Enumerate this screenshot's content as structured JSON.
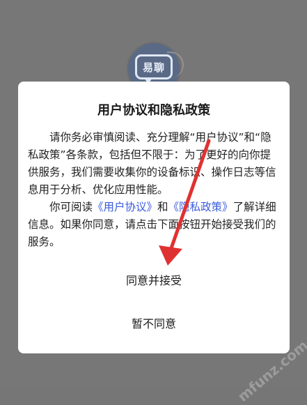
{
  "app": {
    "logo_text": "易聊"
  },
  "dialog": {
    "title": "用户协议和隐私政策",
    "paragraph1": "请你务必审慎阅读、充分理解“用户协议”和“隐私政策”各条款，包括但不限于：为了更好的向你提供服务，我们需要收集你的设备标识、操作日志等信息用于分析、优化应用性能。",
    "paragraph2_prefix": "你可阅读",
    "user_agreement_link": "《用户协议》",
    "paragraph2_and": "和",
    "privacy_policy_link": "《隐私政策》",
    "paragraph2_suffix": "了解详细信息。如果你同意，请点击下面按钮开始接受我们的服务。",
    "agree_button": "同意并接受",
    "reject_button": "暂不同意"
  },
  "watermark": {
    "text": "mfunz.com"
  },
  "colors": {
    "backdrop": "#777777",
    "dialog_bg": "#ffffff",
    "link": "#3b5bdb",
    "arrow": "#e03131"
  },
  "icons": {
    "logo": "chat-bubble-icon",
    "arrow": "red-arrow-annotation"
  }
}
